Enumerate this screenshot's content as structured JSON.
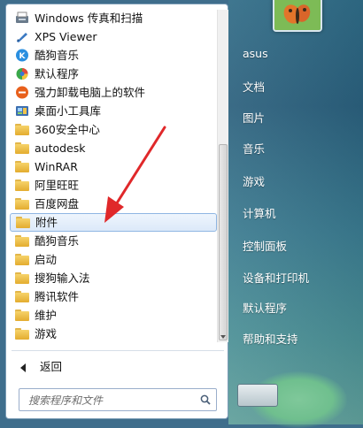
{
  "programs": [
    {
      "label": "Windows 传真和扫描",
      "icon": "fax-icon",
      "type": "app"
    },
    {
      "label": "XPS Viewer",
      "icon": "xps-icon",
      "type": "app"
    },
    {
      "label": "酷狗音乐",
      "icon": "kugou-icon",
      "type": "app"
    },
    {
      "label": "默认程序",
      "icon": "default-programs-icon",
      "type": "app"
    },
    {
      "label": "强力卸载电脑上的软件",
      "icon": "uninstall-icon",
      "type": "app"
    },
    {
      "label": "桌面小工具库",
      "icon": "gadgets-icon",
      "type": "app"
    },
    {
      "label": "360安全中心",
      "icon": "folder-icon",
      "type": "folder"
    },
    {
      "label": "autodesk",
      "icon": "folder-icon",
      "type": "folder"
    },
    {
      "label": "WinRAR",
      "icon": "folder-icon",
      "type": "folder"
    },
    {
      "label": "阿里旺旺",
      "icon": "folder-icon",
      "type": "folder"
    },
    {
      "label": "百度网盘",
      "icon": "folder-icon",
      "type": "folder"
    },
    {
      "label": "附件",
      "icon": "folder-icon",
      "type": "folder",
      "selected": true
    },
    {
      "label": "酷狗音乐",
      "icon": "folder-icon",
      "type": "folder"
    },
    {
      "label": "启动",
      "icon": "folder-icon",
      "type": "folder"
    },
    {
      "label": "搜狗输入法",
      "icon": "folder-icon",
      "type": "folder"
    },
    {
      "label": "腾讯软件",
      "icon": "folder-icon",
      "type": "folder"
    },
    {
      "label": "维护",
      "icon": "folder-icon",
      "type": "folder"
    },
    {
      "label": "游戏",
      "icon": "folder-icon",
      "type": "folder"
    }
  ],
  "back": {
    "label": "返回"
  },
  "search": {
    "placeholder": "搜索程序和文件"
  },
  "right_menu": {
    "items": [
      {
        "label": "asus"
      },
      {
        "label": "文档"
      },
      {
        "label": "图片"
      },
      {
        "label": "音乐"
      },
      {
        "label": "游戏"
      },
      {
        "label": "计算机"
      },
      {
        "label": "控制面板"
      },
      {
        "label": "设备和打印机"
      },
      {
        "label": "默认程序"
      },
      {
        "label": "帮助和支持"
      }
    ]
  },
  "colors": {
    "annotation_arrow": "#e0282a",
    "selection_border": "#8fb6e3",
    "folder": "#e3ac2f"
  }
}
